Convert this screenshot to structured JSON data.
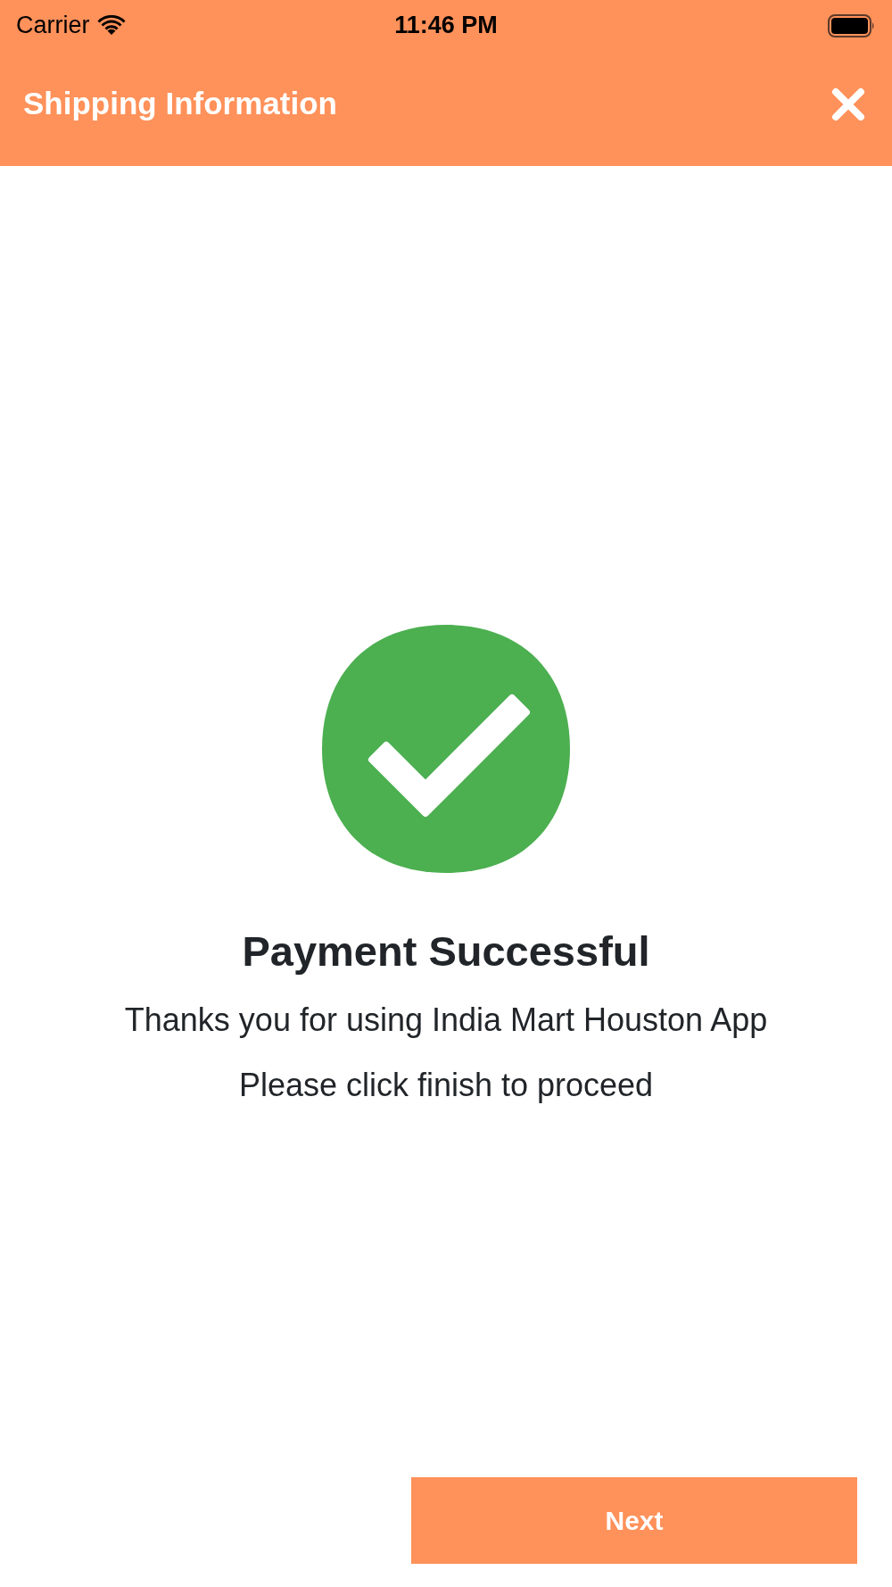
{
  "status_bar": {
    "carrier": "Carrier",
    "time": "11:46 PM"
  },
  "header": {
    "title": "Shipping Information"
  },
  "result": {
    "title": "Payment Successful",
    "lines": [
      "Thanks you for using India Mart Houston App",
      "Please click finish to proceed"
    ]
  },
  "footer": {
    "button": "Next"
  }
}
